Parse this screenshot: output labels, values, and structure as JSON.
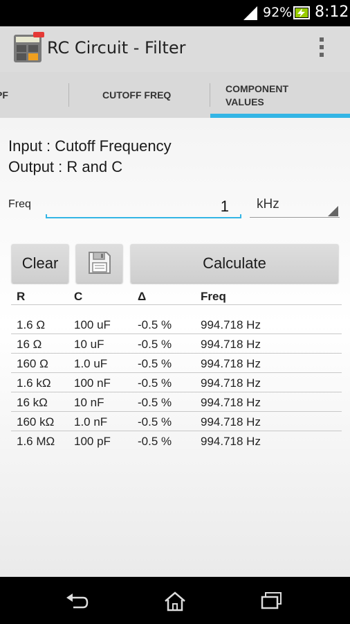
{
  "status_bar": {
    "battery_percent": "92%",
    "time": "8:12",
    "icons": [
      "signal-icon",
      "battery-charging-icon"
    ]
  },
  "app": {
    "title": "RC Circuit - Filter",
    "icon": "calculator-pro-icon"
  },
  "tabs": [
    {
      "label": "PF",
      "selected": false
    },
    {
      "label": "CUTOFF FREQ",
      "selected": false
    },
    {
      "label": "COMPONENT VALUES",
      "selected": true
    }
  ],
  "accent_color": "#33b5e5",
  "description": {
    "input": "Input : Cutoff Frequency",
    "output": "Output : R and C"
  },
  "freq": {
    "label": "Freq",
    "value": "1",
    "unit": "kHz"
  },
  "buttons": {
    "clear": "Clear",
    "save": "save-icon",
    "calculate": "Calculate"
  },
  "table": {
    "headers": [
      "R",
      "C",
      "Δ",
      "Freq"
    ],
    "rows": [
      [
        "1.6 Ω",
        "100 uF",
        "-0.5 %",
        "994.718 Hz"
      ],
      [
        "16 Ω",
        "10 uF",
        "-0.5 %",
        "994.718 Hz"
      ],
      [
        "160 Ω",
        "1.0 uF",
        "-0.5 %",
        "994.718 Hz"
      ],
      [
        "1.6 kΩ",
        "100 nF",
        "-0.5 %",
        "994.718 Hz"
      ],
      [
        "16 kΩ",
        "10 nF",
        "-0.5 %",
        "994.718 Hz"
      ],
      [
        "160 kΩ",
        "1.0 nF",
        "-0.5 %",
        "994.718 Hz"
      ],
      [
        "1.6 MΩ",
        "100 pF",
        "-0.5 %",
        "994.718 Hz"
      ]
    ]
  },
  "nav": [
    "back-icon",
    "home-icon",
    "recent-apps-icon"
  ]
}
